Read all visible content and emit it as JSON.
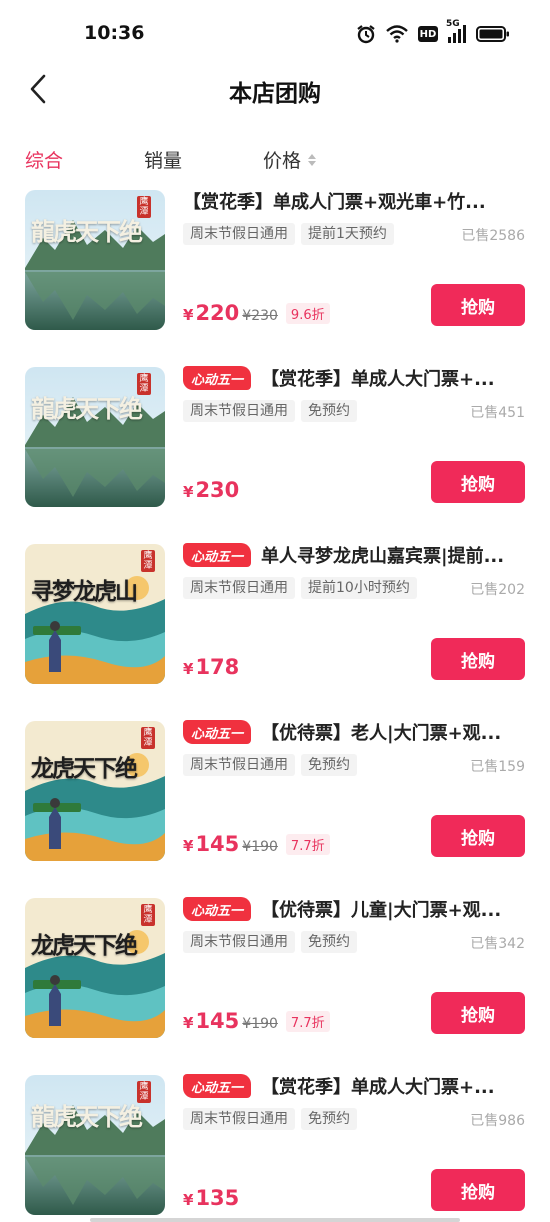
{
  "status_bar": {
    "time": "10:36",
    "hd": "HD",
    "signal": "5G"
  },
  "header": {
    "title": "本店团购"
  },
  "sort_tabs": [
    {
      "label": "综合"
    },
    {
      "label": "销量"
    },
    {
      "label": "价格"
    }
  ],
  "colors": {
    "accent": "#e8335e",
    "buy_button": "#f02a59",
    "promo_badge": "#f0313f"
  },
  "products": [
    {
      "badge": "",
      "title": "【赏花季】单成人门票+观光車+竹...",
      "tags": [
        "周末节假日通用",
        "提前1天预约"
      ],
      "sold": "已售2586",
      "currency": "¥",
      "price": "220",
      "original_price": "¥230",
      "discount": "9.6折",
      "button": "抢购",
      "thumb_text": "龍虎天下绝",
      "thumb_seal": "鹰潭",
      "thumb_style": "lake"
    },
    {
      "badge": "心动五一",
      "title": "【赏花季】单成人大门票+...",
      "tags": [
        "周末节假日通用",
        "免预约"
      ],
      "sold": "已售451",
      "currency": "¥",
      "price": "230",
      "original_price": "",
      "discount": "",
      "button": "抢购",
      "thumb_text": "龍虎天下绝",
      "thumb_seal": "鹰潭",
      "thumb_style": "lake"
    },
    {
      "badge": "心动五一",
      "title": "单人寻梦龙虎山嘉宾票|提前...",
      "tags": [
        "周末节假日通用",
        "提前10小时预约"
      ],
      "sold": "已售202",
      "currency": "¥",
      "price": "178",
      "original_price": "",
      "discount": "",
      "button": "抢购",
      "thumb_text": "寻梦龙虎山",
      "thumb_seal": "鹰潭",
      "thumb_style": "art"
    },
    {
      "badge": "心动五一",
      "title": "【优待票】老人|大门票+观...",
      "tags": [
        "周末节假日通用",
        "免预约"
      ],
      "sold": "已售159",
      "currency": "¥",
      "price": "145",
      "original_price": "¥190",
      "discount": "7.7折",
      "button": "抢购",
      "thumb_text": "龙虎天下绝",
      "thumb_seal": "鹰潭",
      "thumb_style": "art"
    },
    {
      "badge": "心动五一",
      "title": "【优待票】儿童|大门票+观...",
      "tags": [
        "周末节假日通用",
        "免预约"
      ],
      "sold": "已售342",
      "currency": "¥",
      "price": "145",
      "original_price": "¥190",
      "discount": "7.7折",
      "button": "抢购",
      "thumb_text": "龙虎天下绝",
      "thumb_seal": "鹰潭",
      "thumb_style": "art"
    },
    {
      "badge": "心动五一",
      "title": "【赏花季】单成人大门票+...",
      "tags": [
        "周末节假日通用",
        "免预约"
      ],
      "sold": "已售986",
      "currency": "¥",
      "price": "135",
      "original_price": "",
      "discount": "",
      "button": "抢购",
      "thumb_text": "龍虎天下绝",
      "thumb_seal": "鹰潭",
      "thumb_style": "lake"
    }
  ]
}
